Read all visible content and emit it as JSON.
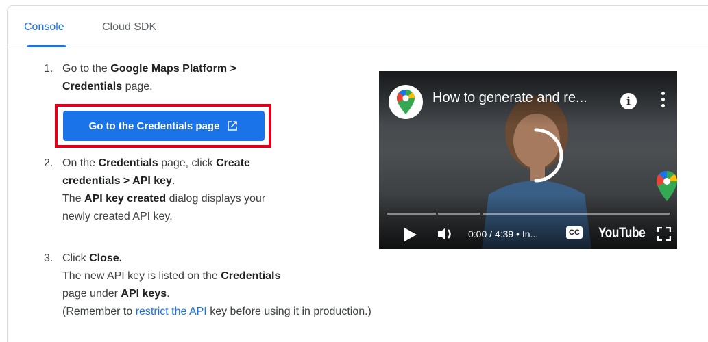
{
  "tabs": [
    {
      "label": "Console",
      "active": true
    },
    {
      "label": "Cloud SDK",
      "active": false
    }
  ],
  "steps": [
    {
      "num": "1.",
      "lines": [
        "Go to the ",
        "Google Maps Platform >",
        "Credentials",
        " page."
      ]
    },
    {
      "num": "2.",
      "lines": [
        "On the ",
        "Credentials",
        " page, click ",
        "Create",
        "credentials > API key",
        ".",
        "The ",
        "API key created",
        " dialog displays your",
        "newly created API key."
      ]
    },
    {
      "num": "3.",
      "lines": [
        "Click ",
        "Close.",
        "The new API key is listed on the ",
        "Credentials",
        "page under ",
        "API keys",
        ".",
        "(Remember to ",
        "restrict the API",
        " key before using it in production.)"
      ]
    }
  ],
  "cta_button": {
    "label": "Go to the Credentials page"
  },
  "video": {
    "title": "How to generate and re...",
    "time": "0:00 / 4:39 • In...",
    "cc_label": "CC",
    "youtube_label": "YouTube",
    "progress_fraction": 0.0
  },
  "colors": {
    "accent": "#1a73e8",
    "highlight_outline": "#e0001b"
  }
}
